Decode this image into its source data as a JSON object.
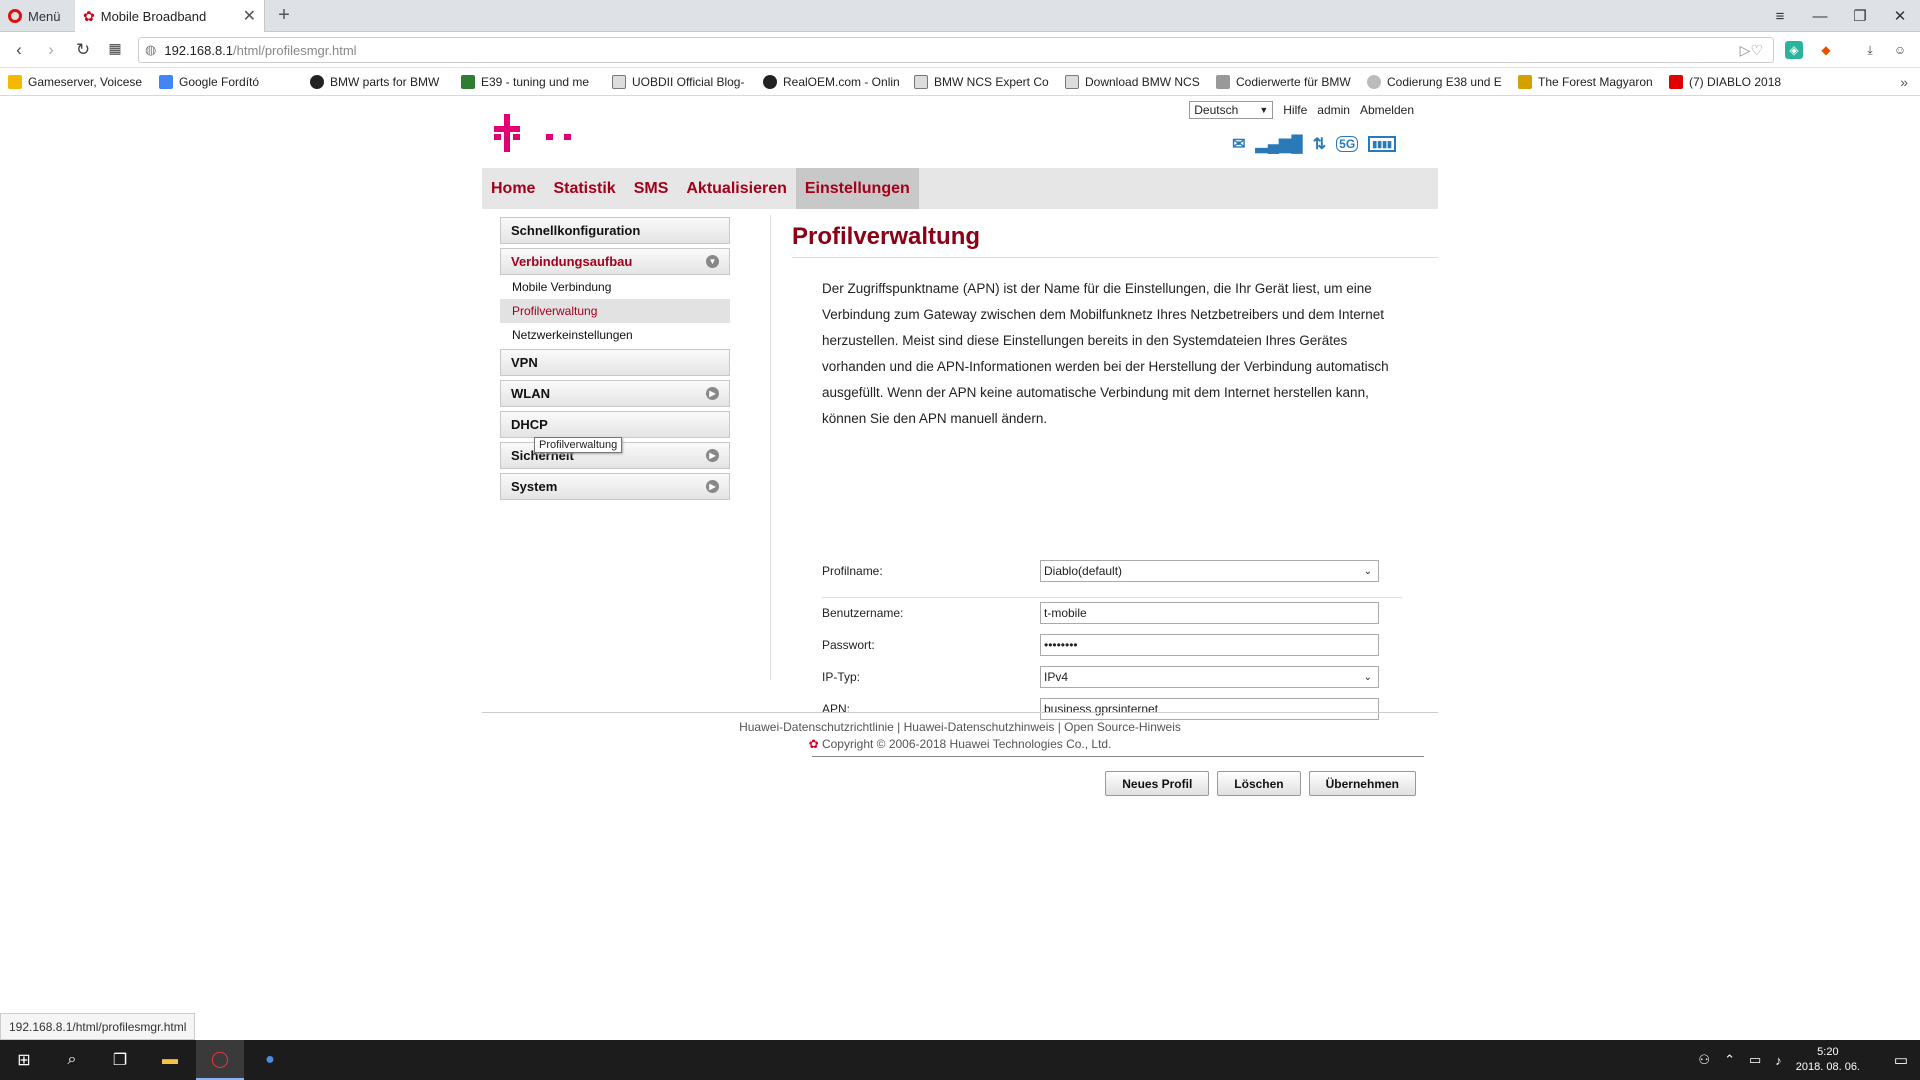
{
  "browser": {
    "menu_label": "Menü",
    "tab_title": "Mobile Broadband",
    "url_host": "192.168.8.1",
    "url_path": "/html/profilesmgr.html",
    "status_url": "192.168.8.1/html/profilesmgr.html",
    "bookmarks": [
      {
        "label": "Gameserver, Voicese",
        "color": "#f5b800"
      },
      {
        "label": "Google Fordító",
        "color": "#4285f4"
      },
      {
        "label": "BMW parts for BMW",
        "color": "#222222"
      },
      {
        "label": "E39 - tuning und me",
        "color": "#2e7d32"
      },
      {
        "label": "UOBDII Official Blog-",
        "color": "#555555"
      },
      {
        "label": "RealOEM.com - Onlin",
        "color": "#222222"
      },
      {
        "label": "BMW NCS Expert Co",
        "color": "#555555"
      },
      {
        "label": "Download BMW NCS",
        "color": "#555555"
      },
      {
        "label": "Codierwerte für BMW",
        "color": "#777777"
      },
      {
        "label": "Codierung E38 und E",
        "color": "#888888"
      },
      {
        "label": "The Forest Magyaron",
        "color": "#d4a000"
      },
      {
        "label": "(7) DIABLO 2018",
        "color": "#e00000"
      }
    ]
  },
  "header": {
    "language": "Deutsch",
    "help": "Hilfe",
    "user": "admin",
    "logout": "Abmelden"
  },
  "nav": {
    "tabs": [
      "Home",
      "Statistik",
      "SMS",
      "Aktualisieren",
      "Einstellungen"
    ]
  },
  "sidebar": {
    "items": [
      {
        "label": "Schnellkonfiguration"
      },
      {
        "label": "Verbindungsaufbau"
      },
      {
        "label": "VPN"
      },
      {
        "label": "WLAN"
      },
      {
        "label": "DHCP"
      },
      {
        "label": "Sicherheit"
      },
      {
        "label": "System"
      }
    ],
    "subitems": [
      "Mobile Verbindung",
      "Profilverwaltung",
      "Netzwerkeinstellungen"
    ],
    "tooltip": "Profilverwaltung"
  },
  "content": {
    "title": "Profilverwaltung",
    "description": "Der Zugriffspunktname (APN) ist der Name für die Einstellungen, die Ihr Gerät liest, um eine Verbindung zum Gateway zwischen dem Mobilfunknetz Ihres Netzbetreibers und dem Internet herzustellen. Meist sind diese Einstellungen bereits in den Systemdateien Ihres Gerätes vorhanden und die APN-Informationen werden bei der Herstellung der Verbindung automatisch ausgefüllt. Wenn der APN keine automatische Verbindung mit dem Internet herstellen kann, können Sie den APN manuell ändern.",
    "fields": {
      "profile_label": "Profilname:",
      "profile_value": "Diablo(default)",
      "user_label": "Benutzername:",
      "user_value": "t-mobile",
      "pass_label": "Passwort:",
      "pass_value": "••••••••",
      "iptype_label": "IP-Typ:",
      "iptype_value": "IPv4",
      "apn_label": "APN:",
      "apn_value": "business.gprsinternet"
    },
    "buttons": {
      "new": "Neues Profil",
      "delete": "Löschen",
      "apply": "Übernehmen"
    }
  },
  "footer": {
    "links": [
      "Huawei-Datenschutzrichtlinie",
      "Huawei-Datenschutzhinweis",
      "Open Source-Hinweis"
    ],
    "copyright": "Copyright © 2006-2018 Huawei Technologies Co., Ltd."
  },
  "taskbar": {
    "time": "5:20",
    "date": "2018. 08. 06."
  },
  "colors": {
    "brand_magenta": "#e20074",
    "nav_red": "#a3001b"
  }
}
